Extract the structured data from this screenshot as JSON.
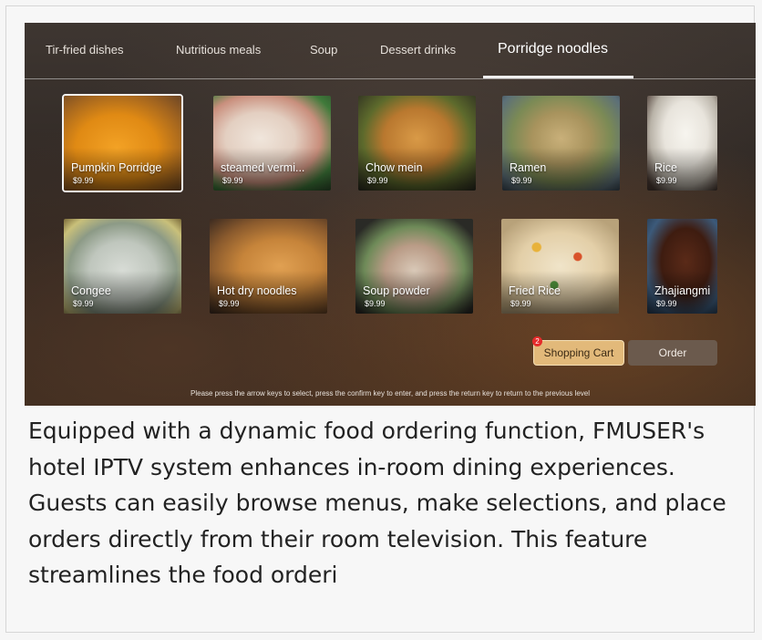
{
  "tabs": [
    {
      "label": "Tir-fried dishes",
      "active": false
    },
    {
      "label": "Nutritious meals",
      "active": false
    },
    {
      "label": "Soup",
      "active": false
    },
    {
      "label": "Dessert drinks",
      "active": false
    },
    {
      "label": "Porridge noodles",
      "active": true
    }
  ],
  "dishes": [
    {
      "name": "Pumpkin Porridge",
      "price": "$9.99",
      "selected": true
    },
    {
      "name": "steamed vermi...",
      "price": "$9.99"
    },
    {
      "name": "Chow mein",
      "price": "$9.99"
    },
    {
      "name": "Ramen",
      "price": "$9.99"
    },
    {
      "name": "Rice",
      "price": "$9.99"
    },
    {
      "name": "Congee",
      "price": "$9.99"
    },
    {
      "name": "Hot dry noodles",
      "price": "$9.99"
    },
    {
      "name": "Soup powder",
      "price": "$9.99"
    },
    {
      "name": "Fried Rice",
      "price": "$9.99"
    },
    {
      "name": "Zhajiangmi",
      "price": "$9.99"
    }
  ],
  "cart": {
    "label": "Shopping Cart",
    "count": "2"
  },
  "order": {
    "label": "Order"
  },
  "hint": "Please press the arrow keys to select, press the confirm key to enter, and press the return key to return to the previous level",
  "caption": "Equipped with a dynamic food ordering function, FMUSER's hotel IPTV system enhances in-room dining experiences. Guests can easily browse menus, make selections, and place orders directly from their room television. This feature streamlines the food orderi",
  "colors": {
    "accent": "#e2b97a",
    "badge": "#e52b2b",
    "order_button": "#6b5a4d"
  }
}
